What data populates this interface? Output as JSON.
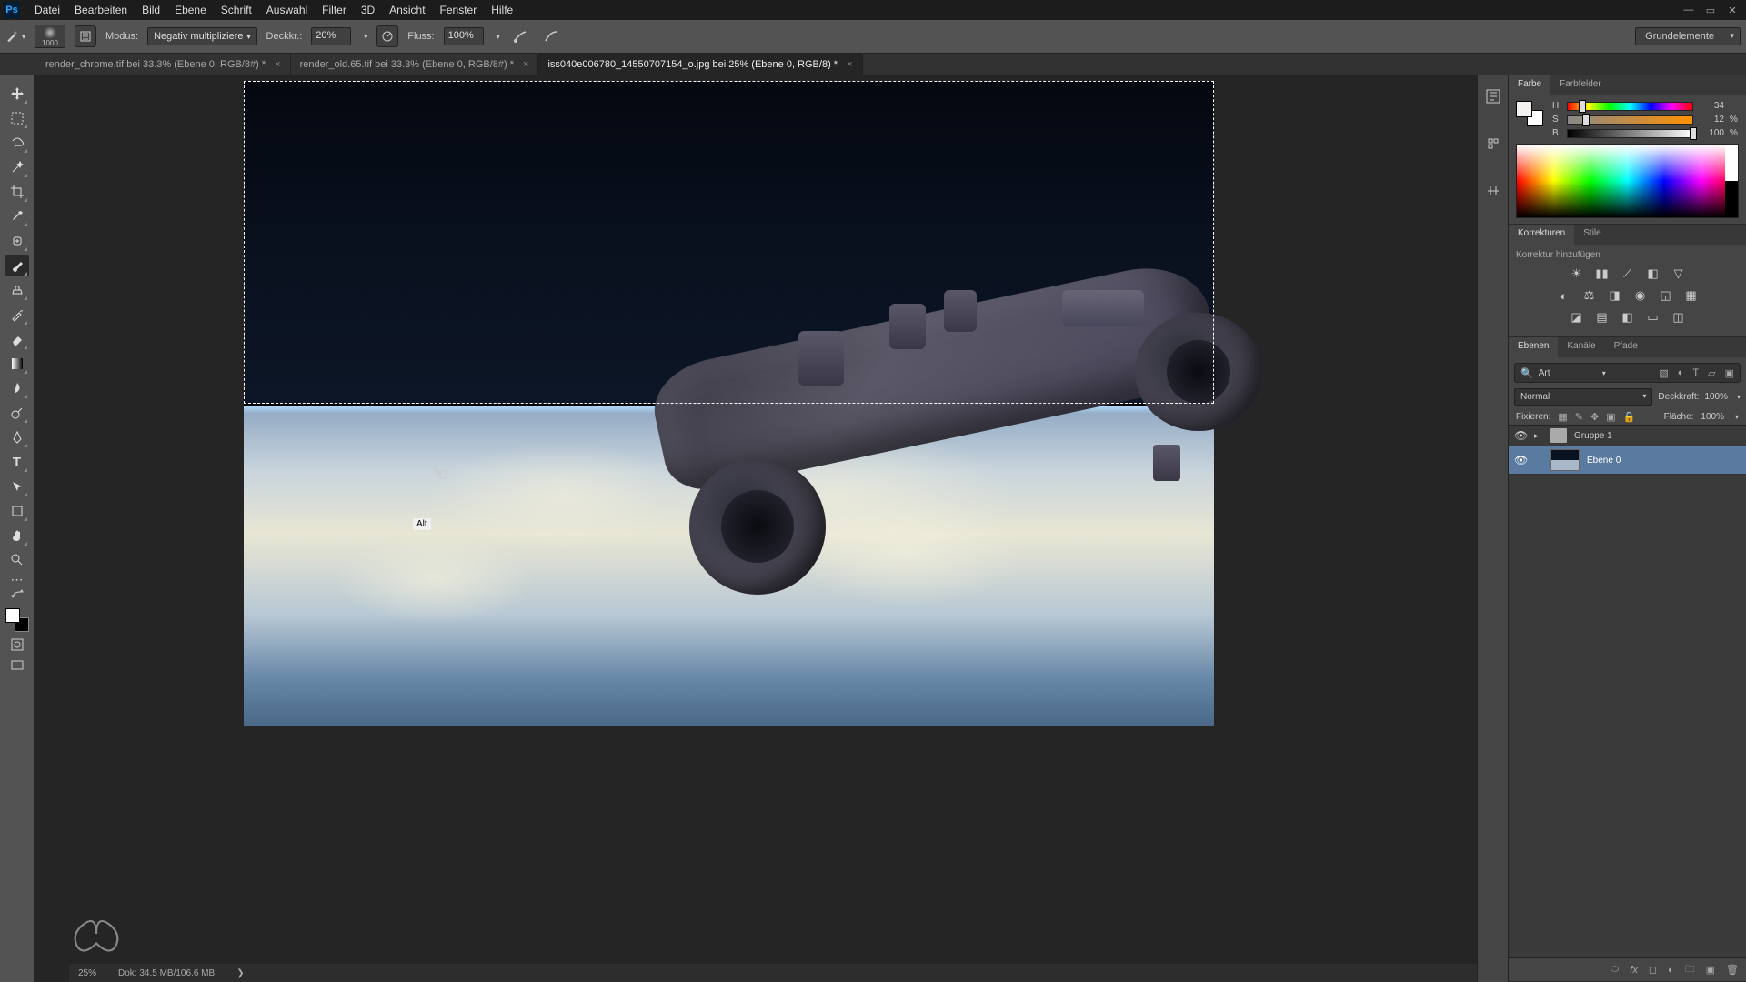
{
  "app": {
    "logo": "Ps"
  },
  "menu": [
    "Datei",
    "Bearbeiten",
    "Bild",
    "Ebene",
    "Schrift",
    "Auswahl",
    "Filter",
    "3D",
    "Ansicht",
    "Fenster",
    "Hilfe"
  ],
  "options": {
    "brush_size": "1000",
    "mode_label": "Modus:",
    "mode_value": "Negativ multipliziere",
    "opacity_label": "Deckkr.:",
    "opacity_value": "20%",
    "flow_label": "Fluss:",
    "flow_value": "100%",
    "preset": "Grundelemente"
  },
  "tabs": [
    {
      "title": "render_chrome.tif bei 33.3% (Ebene 0, RGB/8#) *",
      "active": false
    },
    {
      "title": "render_old.65.tif bei 33.3% (Ebene 0, RGB/8#) *",
      "active": false
    },
    {
      "title": "iss040e006780_14550707154_o.jpg bei 25%  (Ebene 0, RGB/8) *",
      "active": true
    }
  ],
  "cursor_badge": "Alt",
  "status": {
    "zoom": "25%",
    "docinfo": "Dok: 34.5 MB/106.6 MB"
  },
  "color": {
    "tab1": "Farbe",
    "tab2": "Farbfelder",
    "h_label": "H",
    "h_val": "34",
    "s_label": "S",
    "s_val": "12",
    "b_label": "B",
    "b_val": "100",
    "pct": "%"
  },
  "adjustments": {
    "tab1": "Korrekturen",
    "tab2": "Stile",
    "hint": "Korrektur hinzufügen"
  },
  "layers": {
    "tab1": "Ebenen",
    "tab2": "Kanäle",
    "tab3": "Pfade",
    "search_icon": "🔍",
    "search_kind": "Art",
    "blend": "Normal",
    "opacity_label": "Deckkraft:",
    "opacity_value": "100%",
    "lock_label": "Fixieren:",
    "fill_label": "Fläche:",
    "fill_value": "100%",
    "items": [
      {
        "name": "Gruppe 1",
        "type": "group"
      },
      {
        "name": "Ebene 0",
        "type": "layer"
      }
    ]
  }
}
